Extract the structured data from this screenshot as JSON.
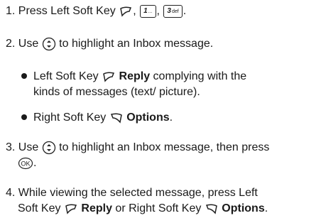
{
  "steps": [
    {
      "number": "1.",
      "text_before": "Press Left Soft Key",
      "sep1": ",",
      "key1": {
        "num": "1",
        "letters": "..."
      },
      "sep2": ",",
      "key2": {
        "num": "3",
        "letters": "def"
      },
      "end": "."
    },
    {
      "number": "2.",
      "text_before": "Use",
      "text_after": "to highlight an Inbox message."
    },
    {
      "number": "3.",
      "text_before": "Use",
      "text_after": "to highlight an Inbox message, then press"
    },
    {
      "number": "4.",
      "line1": "While viewing the selected message, press Left",
      "line2_a": "Soft Key",
      "line2_reply": "Reply",
      "line2_b": "or Right Soft Key",
      "line2_options": "Options",
      "line2_end": "."
    }
  ],
  "bullets": [
    {
      "text_before": "Left Soft Key",
      "bold": "Reply",
      "text_after": "complying with the",
      "line2": "kinds of messages (text/ picture)."
    },
    {
      "text_before": "Right Soft Key",
      "bold": "Options",
      "text_after": "."
    }
  ],
  "icons": [
    "left-soft-key-icon",
    "right-soft-key-icon",
    "nav-key-icon",
    "ok-key-icon"
  ]
}
